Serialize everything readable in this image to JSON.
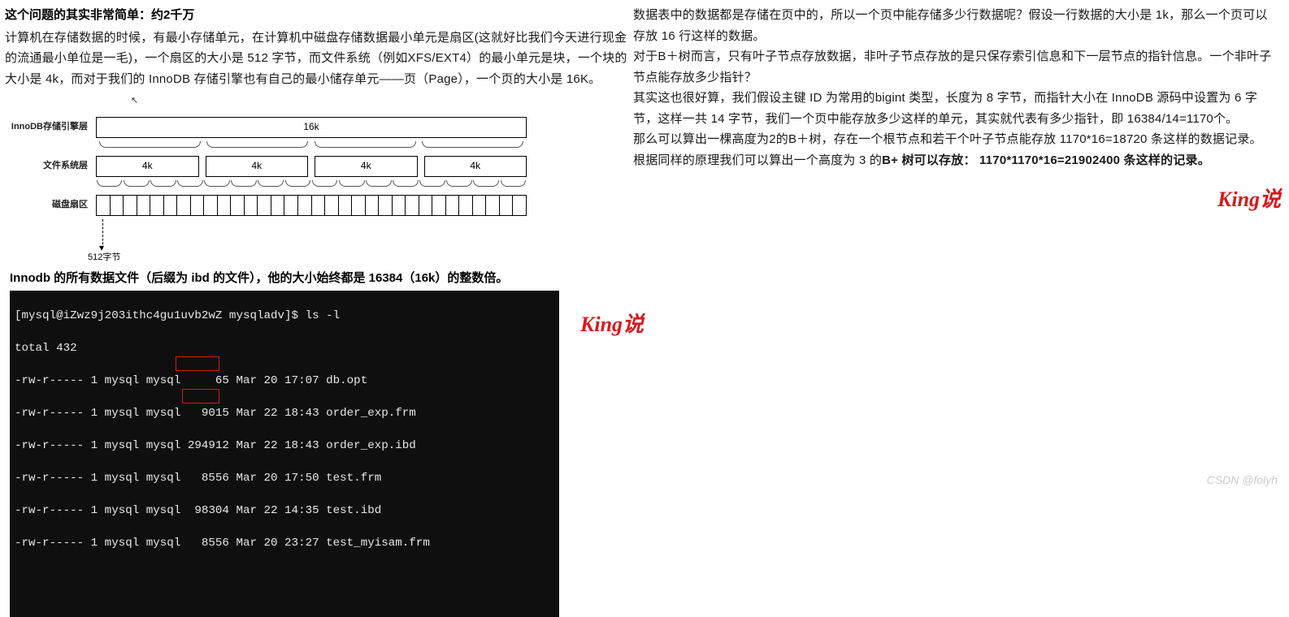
{
  "left": {
    "title": "这个问题的其实非常简单：约2千万",
    "p1": "计算机在存储数据的时候，有最小存储单元，在计算机中磁盘存储数据最小单元是扇区(这就好比我们今天进行现金的流通最小单位是一毛)，一个扇区的大小是 512 字节，而文件系统（例如XFS/EXT4）的最小单元是块，一个块的大小是 4k，而对于我们的 InnoDB 存储引擎也有自己的最小储存单元——页（Page），一个页的大小是 16K。",
    "diagram": {
      "label_innodb": "InnoDB存储引擎层",
      "label_fs": "文件系统层",
      "label_disk": "磁盘扇区",
      "v16k": "16k",
      "v4k": "4k",
      "caption": "512字节"
    },
    "sub2": "Innodb 的所有数据文件（后缀为 ibd 的文件），他的大小始终都是 16384（16k）的整数倍。",
    "term": {
      "prompt": "[mysql@iZwz9j203ithc4gu1uvb2wZ mysqladv]$ ls -l",
      "total": "total 432",
      "l1": "-rw-r----- 1 mysql mysql     65 Mar 20 17:07 db.opt",
      "l2": "-rw-r----- 1 mysql mysql   9015 Mar 22 18:43 order_exp.frm",
      "l3": "-rw-r----- 1 mysql mysql 294912 Mar 22 18:43 order_exp.ibd",
      "l4": "-rw-r----- 1 mysql mysql   8556 Mar 20 17:50 test.frm",
      "l5": "-rw-r----- 1 mysql mysql  98304 Mar 22 14:35 test.ibd",
      "l6": "-rw-r----- 1 mysql mysql   8556 Mar 20 23:27 test_myisam.frm"
    }
  },
  "right": {
    "p1": "数据表中的数据都是存储在页中的，所以一个页中能存储多少行数据呢？假设一行数据的大小是 1k，那么一个页可以存放 16 行这样的数据。",
    "p2": "对于B＋树而言，只有叶子节点存放数据，非叶子节点存放的是只保存索引信息和下一层节点的指针信息。一个非叶子节点能存放多少指针？",
    "p3": "其实这也很好算，我们假设主键 ID 为常用的bigint 类型，长度为 8 字节，而指针大小在 InnoDB 源码中设置为 6 字节，这样一共 14 字节，我们一个页中能存放多少这样的单元，其实就代表有多少指针，即 16384/14=1170个。",
    "p4": "那么可以算出一棵高度为2的B＋树，存在一个根节点和若干个叶子节点能存放 1170*16=18720 条这样的数据记录。",
    "p5a": "根据同样的原理我们可以算出一个高度为 3 的",
    "p5b": "B+ 树可以存放：  1170*1170*16=21902400 条这样的记录。"
  },
  "watermark": "King说",
  "csdn": "CSDN @folyh"
}
